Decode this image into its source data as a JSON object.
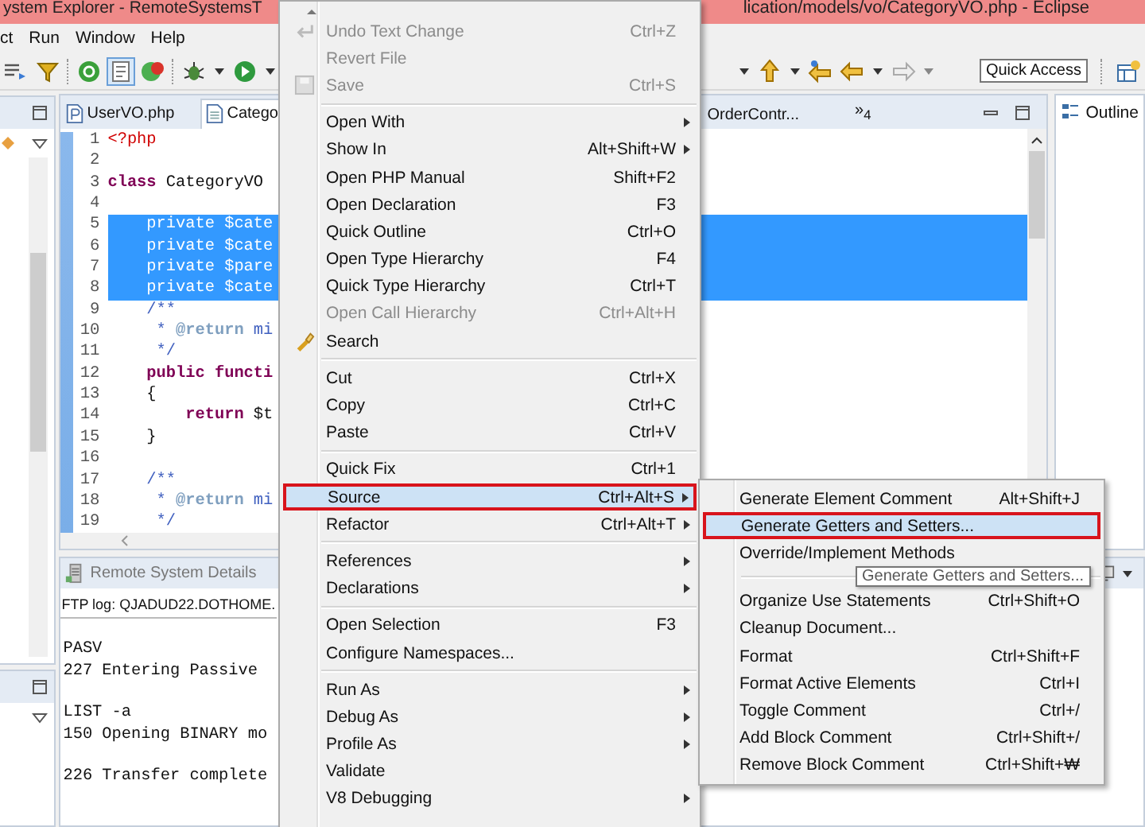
{
  "window": {
    "title_left": "ystem Explorer - RemoteSystemsT",
    "title_right": "lication/models/vo/CategoryVO.php - Eclipse"
  },
  "menubar": [
    "ct",
    "Run",
    "Window",
    "Help"
  ],
  "toolbar": {
    "quick_access": "Quick Access"
  },
  "editor": {
    "tabs": [
      {
        "label": "UserVO.php",
        "selected": false
      },
      {
        "label": "Catego",
        "selected": true
      },
      {
        "label": "OrderContr...",
        "selected": false
      }
    ],
    "overflow": "»$_{4}$",
    "lines": [
      {
        "number": "1",
        "selected": false,
        "segments": [
          {
            "kind": "tag",
            "text": "<?php"
          }
        ]
      },
      {
        "number": "2",
        "selected": false
      },
      {
        "number": "3",
        "selected": false,
        "segments": [
          {
            "kind": "keyword",
            "text": "class"
          },
          {
            "kind": "plain",
            "text": " CategoryVO"
          }
        ]
      },
      {
        "number": "4",
        "selected": false
      },
      {
        "number": "5",
        "selected": true,
        "segments": [
          {
            "kind": "plain",
            "text": "    private $cate"
          }
        ]
      },
      {
        "number": "6",
        "selected": true,
        "segments": [
          {
            "kind": "plain",
            "text": "    private $cate"
          }
        ]
      },
      {
        "number": "7",
        "selected": true,
        "segments": [
          {
            "kind": "plain",
            "text": "    private $pare"
          }
        ]
      },
      {
        "number": "8",
        "selected": true,
        "segments": [
          {
            "kind": "plain",
            "text": "    private $cate"
          }
        ]
      },
      {
        "number": "9",
        "selected": false,
        "segments": [
          {
            "kind": "comment",
            "text": "    /**"
          }
        ]
      },
      {
        "number": "10",
        "selected": false,
        "segments": [
          {
            "kind": "comment",
            "text": "     * "
          },
          {
            "kind": "doctag",
            "text": "@return"
          },
          {
            "kind": "comment",
            "text": " mi"
          }
        ]
      },
      {
        "number": "11",
        "selected": false,
        "segments": [
          {
            "kind": "comment",
            "text": "     */"
          }
        ]
      },
      {
        "number": "12",
        "selected": false,
        "segments": [
          {
            "kind": "keyword",
            "text": "    public functi"
          }
        ]
      },
      {
        "number": "13",
        "selected": false,
        "segments": [
          {
            "kind": "plain",
            "text": "    {"
          }
        ]
      },
      {
        "number": "14",
        "selected": false,
        "segments": [
          {
            "kind": "keyword",
            "text": "        return"
          },
          {
            "kind": "plain",
            "text": " $t"
          }
        ]
      },
      {
        "number": "15",
        "selected": false,
        "segments": [
          {
            "kind": "plain",
            "text": "    }"
          }
        ]
      },
      {
        "number": "16",
        "selected": false
      },
      {
        "number": "17",
        "selected": false,
        "segments": [
          {
            "kind": "comment",
            "text": "    /**"
          }
        ]
      },
      {
        "number": "18",
        "selected": false,
        "segments": [
          {
            "kind": "comment",
            "text": "     * "
          },
          {
            "kind": "doctag",
            "text": "@return"
          },
          {
            "kind": "comment",
            "text": " mi"
          }
        ]
      },
      {
        "number": "19",
        "selected": false,
        "segments": [
          {
            "kind": "comment",
            "text": "     */"
          }
        ]
      }
    ]
  },
  "outline": {
    "title": "Outline"
  },
  "console": {
    "tab": "Remote System Details",
    "header": "FTP log: QJADUD22.DOTHOME.",
    "blocks": [
      {
        "lines": [
          "PASV",
          "227 Entering Passive"
        ]
      },
      {
        "lines": [
          "LIST -a",
          "150 Opening BINARY mo"
        ]
      },
      {
        "lines": [
          "226 Transfer complete"
        ]
      }
    ]
  },
  "context_menu": {
    "items": [
      {
        "kind": "item",
        "label": "Undo Text Change",
        "shortcut": "Ctrl+Z",
        "disabled": true,
        "submenu": false,
        "selected": false
      },
      {
        "kind": "item",
        "label": "Revert File",
        "disabled": true,
        "submenu": false,
        "selected": false
      },
      {
        "kind": "item",
        "label": "Save",
        "shortcut": "Ctrl+S",
        "disabled": true,
        "submenu": false,
        "selected": false
      },
      {
        "kind": "separator"
      },
      {
        "kind": "item",
        "label": "Open With",
        "disabled": false,
        "submenu": true,
        "selected": false
      },
      {
        "kind": "item",
        "label": "Show In",
        "shortcut": "Alt+Shift+W",
        "disabled": false,
        "submenu": true,
        "selected": false
      },
      {
        "kind": "item",
        "label": "Open PHP Manual",
        "shortcut": "Shift+F2",
        "disabled": false,
        "submenu": false,
        "selected": false
      },
      {
        "kind": "item",
        "label": "Open Declaration",
        "shortcut": "F3",
        "disabled": false,
        "submenu": false,
        "selected": false
      },
      {
        "kind": "item",
        "label": "Quick Outline",
        "shortcut": "Ctrl+O",
        "disabled": false,
        "submenu": false,
        "selected": false
      },
      {
        "kind": "item",
        "label": "Open Type Hierarchy",
        "shortcut": "F4",
        "disabled": false,
        "submenu": false,
        "selected": false
      },
      {
        "kind": "item",
        "label": "Quick Type Hierarchy",
        "shortcut": "Ctrl+T",
        "disabled": false,
        "submenu": false,
        "selected": false
      },
      {
        "kind": "item",
        "label": "Open Call Hierarchy",
        "shortcut": "Ctrl+Alt+H",
        "disabled": true,
        "submenu": false,
        "selected": false
      },
      {
        "kind": "item",
        "label": "Search",
        "disabled": false,
        "submenu": false,
        "selected": false
      },
      {
        "kind": "separator"
      },
      {
        "kind": "item",
        "label": "Cut",
        "shortcut": "Ctrl+X",
        "disabled": false,
        "submenu": false,
        "selected": false
      },
      {
        "kind": "item",
        "label": "Copy",
        "shortcut": "Ctrl+C",
        "disabled": false,
        "submenu": false,
        "selected": false
      },
      {
        "kind": "item",
        "label": "Paste",
        "shortcut": "Ctrl+V",
        "disabled": false,
        "submenu": false,
        "selected": false
      },
      {
        "kind": "separator"
      },
      {
        "kind": "item",
        "label": "Quick Fix",
        "shortcut": "Ctrl+1",
        "disabled": false,
        "submenu": false,
        "selected": false
      },
      {
        "kind": "item",
        "label": "Source",
        "shortcut": "Ctrl+Alt+S",
        "disabled": false,
        "submenu": true,
        "selected": true
      },
      {
        "kind": "item",
        "label": "Refactor",
        "shortcut": "Ctrl+Alt+T",
        "disabled": false,
        "submenu": true,
        "selected": false
      },
      {
        "kind": "separator"
      },
      {
        "kind": "item",
        "label": "References",
        "disabled": false,
        "submenu": true,
        "selected": false
      },
      {
        "kind": "item",
        "label": "Declarations",
        "disabled": false,
        "submenu": true,
        "selected": false
      },
      {
        "kind": "separator"
      },
      {
        "kind": "item",
        "label": "Open Selection",
        "shortcut": "F3",
        "disabled": false,
        "submenu": false,
        "selected": false
      },
      {
        "kind": "item",
        "label": "Configure Namespaces...",
        "disabled": false,
        "submenu": false,
        "selected": false
      },
      {
        "kind": "separator"
      },
      {
        "kind": "item",
        "label": "Run As",
        "disabled": false,
        "submenu": true,
        "selected": false
      },
      {
        "kind": "item",
        "label": "Debug As",
        "disabled": false,
        "submenu": true,
        "selected": false
      },
      {
        "kind": "item",
        "label": "Profile As",
        "disabled": false,
        "submenu": true,
        "selected": false
      },
      {
        "kind": "item",
        "label": "Validate",
        "disabled": false,
        "submenu": false,
        "selected": false
      },
      {
        "kind": "item",
        "label": "V8 Debugging",
        "disabled": false,
        "submenu": true,
        "selected": false
      }
    ]
  },
  "submenu": {
    "items": [
      {
        "kind": "item",
        "label": "Generate Element Comment",
        "shortcut": "Alt+Shift+J",
        "selected": false
      },
      {
        "kind": "item",
        "label": "Generate Getters and Setters...",
        "selected": true
      },
      {
        "kind": "item",
        "label": "Override/Implement Methods",
        "selected": false
      },
      {
        "kind": "separator"
      },
      {
        "kind": "item",
        "label": "Organize Use Statements",
        "shortcut": "Ctrl+Shift+O",
        "selected": false
      },
      {
        "kind": "item",
        "label": "Cleanup Document...",
        "selected": false
      },
      {
        "kind": "item",
        "label": "Format",
        "shortcut": "Ctrl+Shift+F",
        "selected": false
      },
      {
        "kind": "item",
        "label": "Format Active Elements",
        "shortcut": "Ctrl+I",
        "selected": false
      },
      {
        "kind": "item",
        "label": "Toggle Comment",
        "shortcut": "Ctrl+/",
        "selected": false
      },
      {
        "kind": "item",
        "label": "Add Block Comment",
        "shortcut": "Ctrl+Shift+/",
        "selected": false
      },
      {
        "kind": "item",
        "label": "Remove Block Comment",
        "shortcut": "Ctrl+Shift+₩",
        "selected": false
      }
    ]
  },
  "tooltip": {
    "text": "Generate Getters and Setters..."
  }
}
